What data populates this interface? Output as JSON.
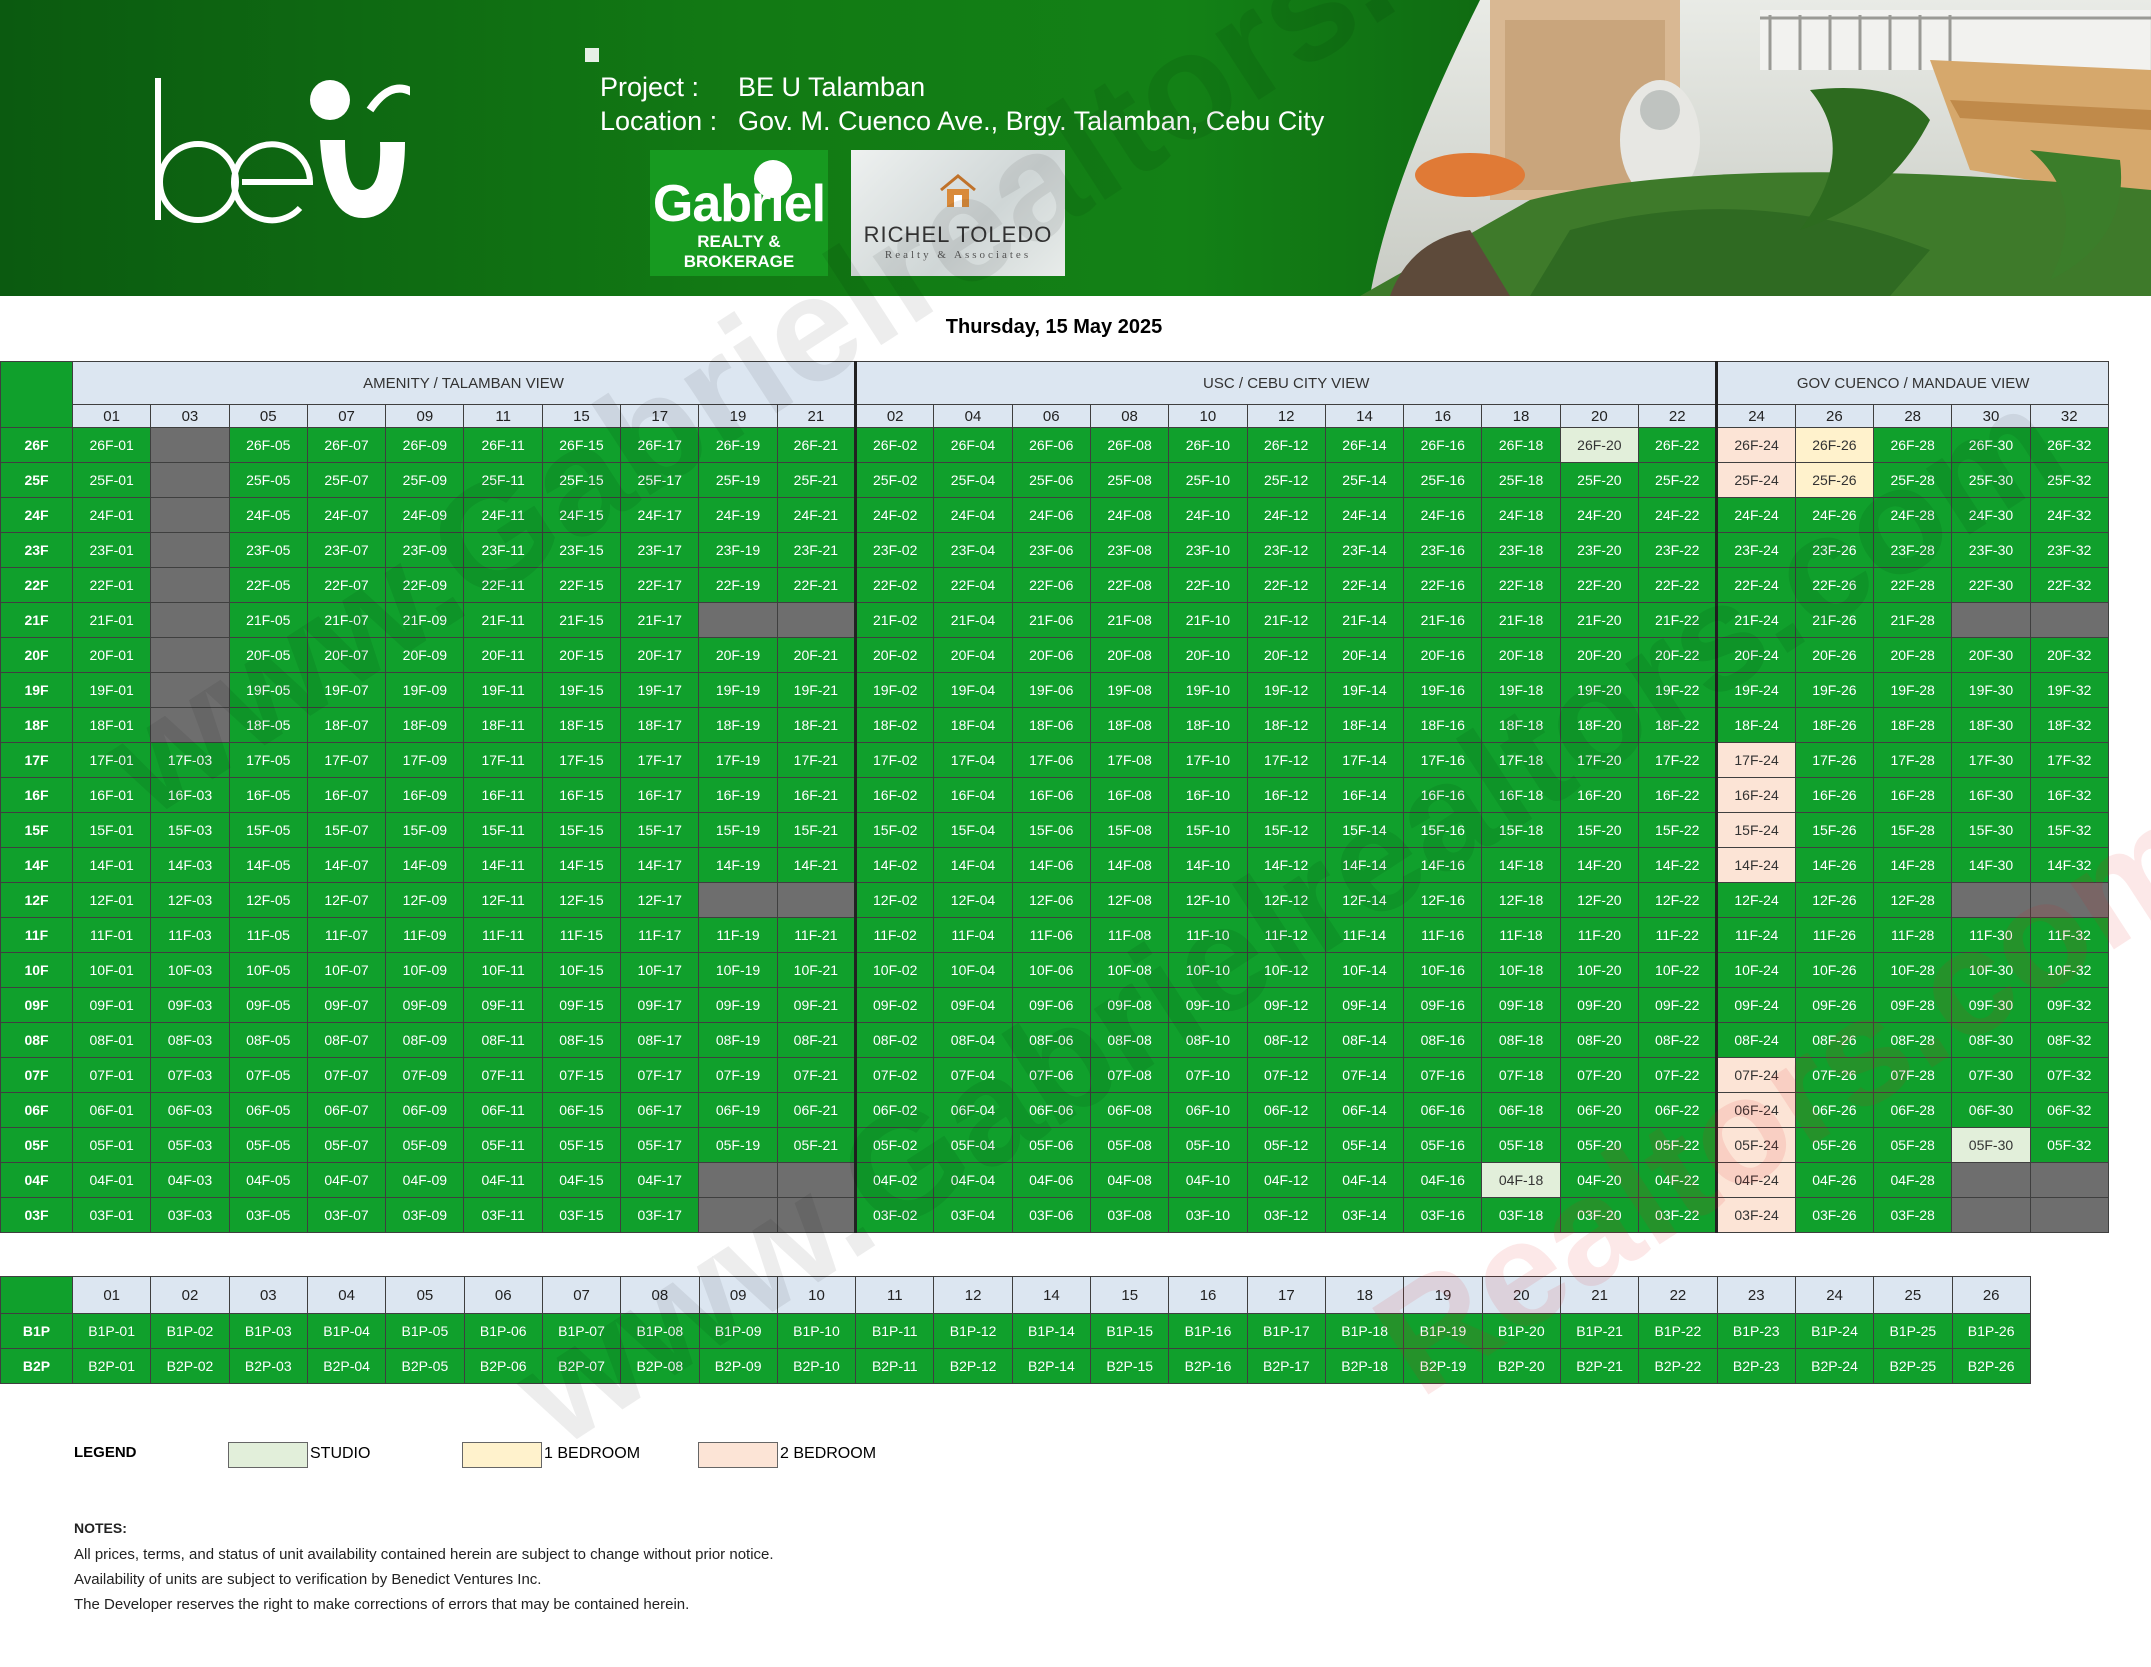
{
  "header": {
    "project_label": "Project :",
    "project_value": "BE U Talamban",
    "location_label": "Location :",
    "location_value": "Gov. M. Cuenco Ave., Brgy. Talamban, Cebu City",
    "brand_logo": "beu",
    "partner_logos": {
      "gabriel_big": "Gabriel",
      "gabriel_small": "REALTY & BROKERAGE",
      "richel_name": "RICHEL TOLEDO",
      "richel_sub": "Realty & Associates"
    }
  },
  "date": "Thursday, 15 May 2025",
  "colors": {
    "available": "#10a02c",
    "unavailable": "#6e6e6e",
    "studio": "#e2efda",
    "one_bedroom": "#fff2cc",
    "two_bedroom": "#fce4d6",
    "header_fill": "#dce6f1"
  },
  "sections": [
    {
      "label": "AMENITY / TALAMBAN VIEW",
      "columns": [
        "01",
        "03",
        "05",
        "07",
        "09",
        "11",
        "15",
        "17",
        "19",
        "21"
      ]
    },
    {
      "label": "USC / CEBU CITY VIEW",
      "columns": [
        "02",
        "04",
        "06",
        "08",
        "10",
        "12",
        "14",
        "16",
        "18",
        "20",
        "22"
      ]
    },
    {
      "label": "GOV CUENCO / MANDAUE VIEW",
      "columns": [
        "24",
        "26",
        "28",
        "30",
        "32"
      ]
    }
  ],
  "floors": [
    "26F",
    "25F",
    "24F",
    "23F",
    "22F",
    "21F",
    "20F",
    "19F",
    "18F",
    "17F",
    "16F",
    "15F",
    "14F",
    "12F",
    "11F",
    "10F",
    "09F",
    "08F",
    "07F",
    "06F",
    "05F",
    "04F",
    "03F"
  ],
  "cell_status": {
    "26F-03": "sold",
    "25F-03": "sold",
    "24F-03": "sold",
    "23F-03": "sold",
    "22F-03": "sold",
    "21F-03": "sold",
    "20F-03": "sold",
    "19F-03": "sold",
    "18F-03": "sold",
    "21F-19": "sold",
    "21F-21": "sold",
    "21F-30": "sold",
    "21F-32": "sold",
    "12F-19": "sold",
    "12F-21": "sold",
    "12F-30": "sold",
    "12F-32": "sold",
    "04F-19": "sold",
    "04F-21": "sold",
    "04F-30": "sold",
    "04F-32": "sold",
    "03F-19": "sold",
    "03F-21": "sold",
    "03F-30": "sold",
    "03F-32": "sold",
    "26F-20": "studio",
    "04F-18": "studio",
    "05F-30": "studio",
    "26F-26": "bed1",
    "25F-26": "bed1",
    "26F-24": "bed2",
    "25F-24": "bed2",
    "17F-24": "bed2",
    "16F-24": "bed2",
    "15F-24": "bed2",
    "14F-24": "bed2",
    "07F-24": "bed2",
    "06F-24": "bed2",
    "05F-24": "bed2",
    "04F-24": "bed2",
    "03F-24": "bed2"
  },
  "parking": {
    "columns": [
      "01",
      "02",
      "03",
      "04",
      "05",
      "06",
      "07",
      "08",
      "09",
      "10",
      "11",
      "12",
      "14",
      "15",
      "16",
      "17",
      "18",
      "19",
      "20",
      "21",
      "22",
      "23",
      "24",
      "25",
      "26"
    ],
    "levels": [
      "B1P",
      "B2P"
    ]
  },
  "legend": {
    "title": "LEGEND",
    "items": [
      {
        "label": "STUDIO",
        "type": "studio"
      },
      {
        "label": "1 BEDROOM",
        "type": "bed1"
      },
      {
        "label": "2 BEDROOM",
        "type": "bed2"
      }
    ]
  },
  "notes": {
    "title": "NOTES:",
    "lines": [
      "All prices, terms, and status of unit availability contained herein are subject to change without prior notice.",
      "Availability of units are subject to verification by Benedict Ventures Inc.",
      "The Developer reserves the right to make corrections of errors that may be contained herein."
    ]
  },
  "watermarks": [
    "www.Gabrielrealtors.com",
    "Realtors.com"
  ]
}
